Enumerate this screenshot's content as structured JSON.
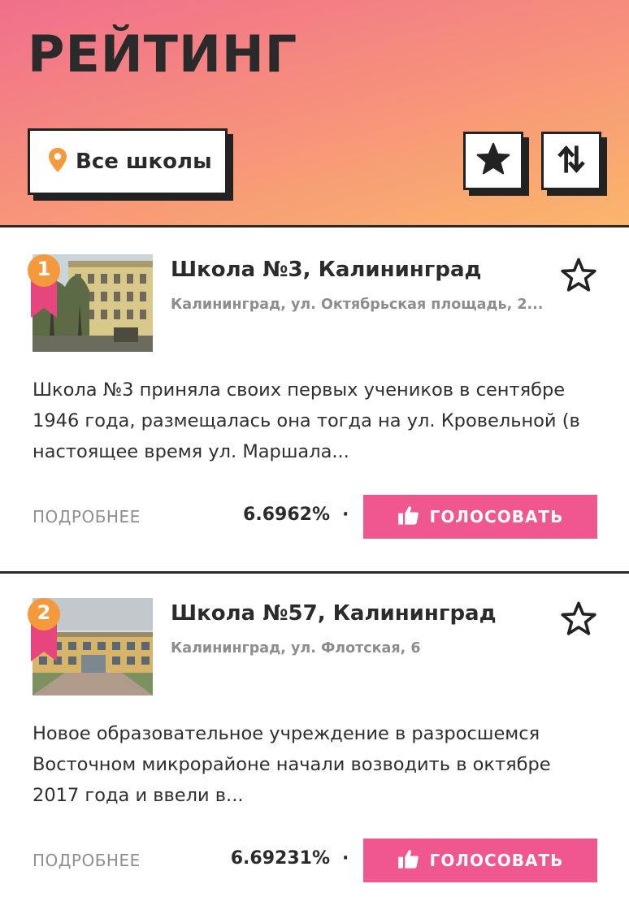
{
  "header": {
    "title": "РЕЙТИНГ",
    "filter_label": "Все школы",
    "filter_icon": "map-pin-icon",
    "favorites_icon": "star-filled-icon",
    "sort_icon": "sort-arrows-icon",
    "gradient_colors": [
      "#f06f8c",
      "#fbb66b"
    ]
  },
  "accent_color": "#f0568f",
  "schools": [
    {
      "rank": "1",
      "name": "Школа №3, Калининград",
      "address": "Калининград, ул. Октябрьская площадь, 2...",
      "description": "Школа №3 приняла своих первых учеников в сентябре 1946 года, размещалась она тогда на ул. Кровельной (в настоящее время ул. Маршала...",
      "more_label": "ПОДРОБНЕЕ",
      "percent": "6.6962%",
      "separator": "·",
      "vote_label": "ГОЛОСОВАТЬ"
    },
    {
      "rank": "2",
      "name": "Школа №57, Калининград",
      "address": "Калининград, ул. Флотская, 6",
      "description": "Новое образовательное учреждение в разросшемся Восточном микрорайоне начали возводить в октябре 2017 года и ввели в...",
      "more_label": "ПОДРОБНЕЕ",
      "percent": "6.69231%",
      "separator": "·",
      "vote_label": "ГОЛОСОВАТЬ"
    }
  ]
}
